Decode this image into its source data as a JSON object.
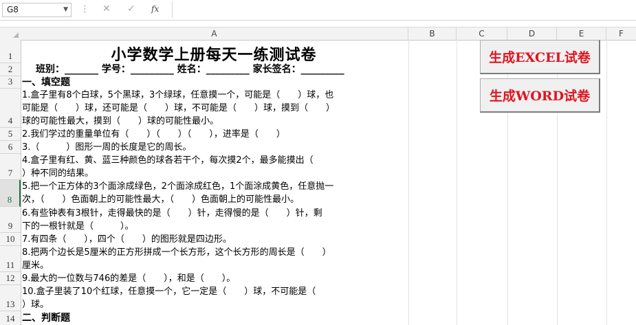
{
  "formula_bar": {
    "name_box": "G8",
    "dropdown_icon": "chevron-down-icon",
    "cancel_icon": "close-icon",
    "enter_icon": "checkmark-icon",
    "fx_label": "fx",
    "formula_value": ""
  },
  "columns": [
    "A",
    "B",
    "C",
    "D",
    "E",
    "F"
  ],
  "rows": [
    "1",
    "2",
    "3",
    "4",
    "5",
    "6",
    "7",
    "8",
    "9",
    "10",
    "11",
    "12",
    "13",
    "14"
  ],
  "selected_row": "8",
  "sheet": {
    "title": "小学数学上册每天一练测试卷",
    "info_line": "班别：_______  学号：_________  姓名：_________  家长签名：_________",
    "section1": "一、填空题",
    "q1_l1": "1.盒子里有8个白球，5个黑球，3个绿球，任意摸一个，可能是（　　）球，也",
    "q1_l2": "可能是（　　）球，还可能是（　　）球，不可能是（　　）球，摸到（　　）",
    "q1_l3": "球的可能性最大，摸到（　　）球的可能性最小。",
    "q2": "2.我们学过的重量单位有（　　）（　　）（　　），进率是（　　）",
    "q3": "3.（　　　）图形一周的长度是它的周长。",
    "q4_l1": "4.盒子里有红、黄、蓝三种颜色的球各若干个，每次摸2个，最多能摸出（",
    "q4_l2": "）种不同的结果。",
    "q5_l1": "5.把一个正方体的3个面涂成绿色，2个面涂成红色，1个面涂成黄色，任意抛一",
    "q5_l2": "次，（　　）色面朝上的可能性最大，（　　）色面朝上的可能性最小。",
    "q6_l1": "6.有些钟表有3根针，走得最快的是（　　）针，走得慢的是（　　）针，剩",
    "q6_l2": "下的一根针就是（　　　）。",
    "q7": "7.有四条（　　），四个（　　）的图形就是四边形。",
    "q8_l1": "8.把两个边长是5厘米的正方形拼成一个长方形，这个长方形的周长是（　　）",
    "q8_l2": "厘米。",
    "q9": "9.最大的一位数与746的差是（　　），和是（　　）。",
    "q10_l1": "10.盒子里装了10个红球，任意摸一个，它一定是（　　）球，不可能是（",
    "q10_l2": "）球。",
    "section2": "二、判断题"
  },
  "buttons": {
    "excel": "生成EXCEL试卷",
    "word": "生成WORD试卷"
  },
  "colors": {
    "button_text": "#e0141e",
    "selection": "#217346"
  }
}
